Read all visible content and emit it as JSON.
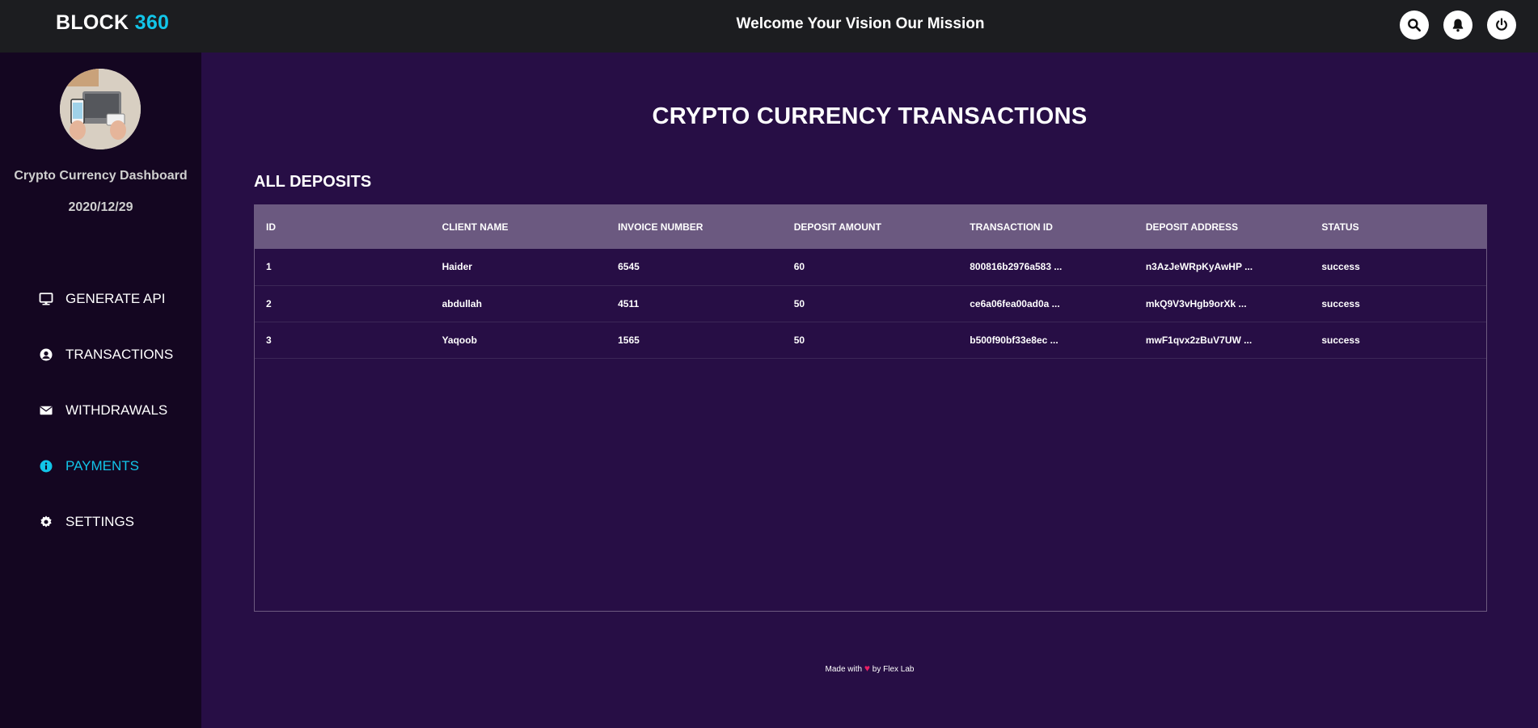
{
  "header": {
    "brand_text": "BLOCK",
    "brand_accent": "360",
    "welcome": "Welcome Your Vision Our Mission",
    "icons": [
      "search-icon",
      "bell-icon",
      "power-icon"
    ]
  },
  "sidebar": {
    "title": "Crypto Currency Dashboard",
    "date": "2020/12/29",
    "items": [
      {
        "label": "GENERATE API",
        "icon": "desktop-icon"
      },
      {
        "label": "TRANSACTIONS",
        "icon": "user-circle-icon"
      },
      {
        "label": "WITHDRAWALS",
        "icon": "envelope-icon"
      },
      {
        "label": "PAYMENTS",
        "icon": "info-icon",
        "active": true
      },
      {
        "label": "SETTINGS",
        "icon": "gear-icon"
      }
    ]
  },
  "main": {
    "title": "CRYPTO CURRENCY TRANSACTIONS",
    "section_title": "ALL DEPOSITS",
    "table": {
      "columns": [
        "ID",
        "CLIENT NAME",
        "INVOICE NUMBER",
        "DEPOSIT AMOUNT",
        "TRANSACTION ID",
        "DEPOSIT ADDRESS",
        "STATUS"
      ],
      "rows": [
        [
          "1",
          "Haider",
          "6545",
          "60",
          "800816b2976a583 ...",
          "n3AzJeWRpKyAwHP ...",
          "success"
        ],
        [
          "2",
          "abdullah",
          "4511",
          "50",
          "ce6a06fea00ad0a ...",
          "mkQ9V3vHgb9orXk ...",
          "success"
        ],
        [
          "3",
          "Yaqoob",
          "1565",
          "50",
          "b500f90bf33e8ec ...",
          "mwF1qvx2zBuV7UW ...",
          "success"
        ]
      ]
    }
  },
  "footer": {
    "prefix": "Made with",
    "suffix": "by Flex Lab"
  },
  "colors": {
    "accent": "#12c5e8",
    "topbar": "#1c1d20",
    "sidebar": "#140621",
    "main_bg": "#270e45",
    "table_header": "#6b5980",
    "heart": "#e91e63"
  }
}
